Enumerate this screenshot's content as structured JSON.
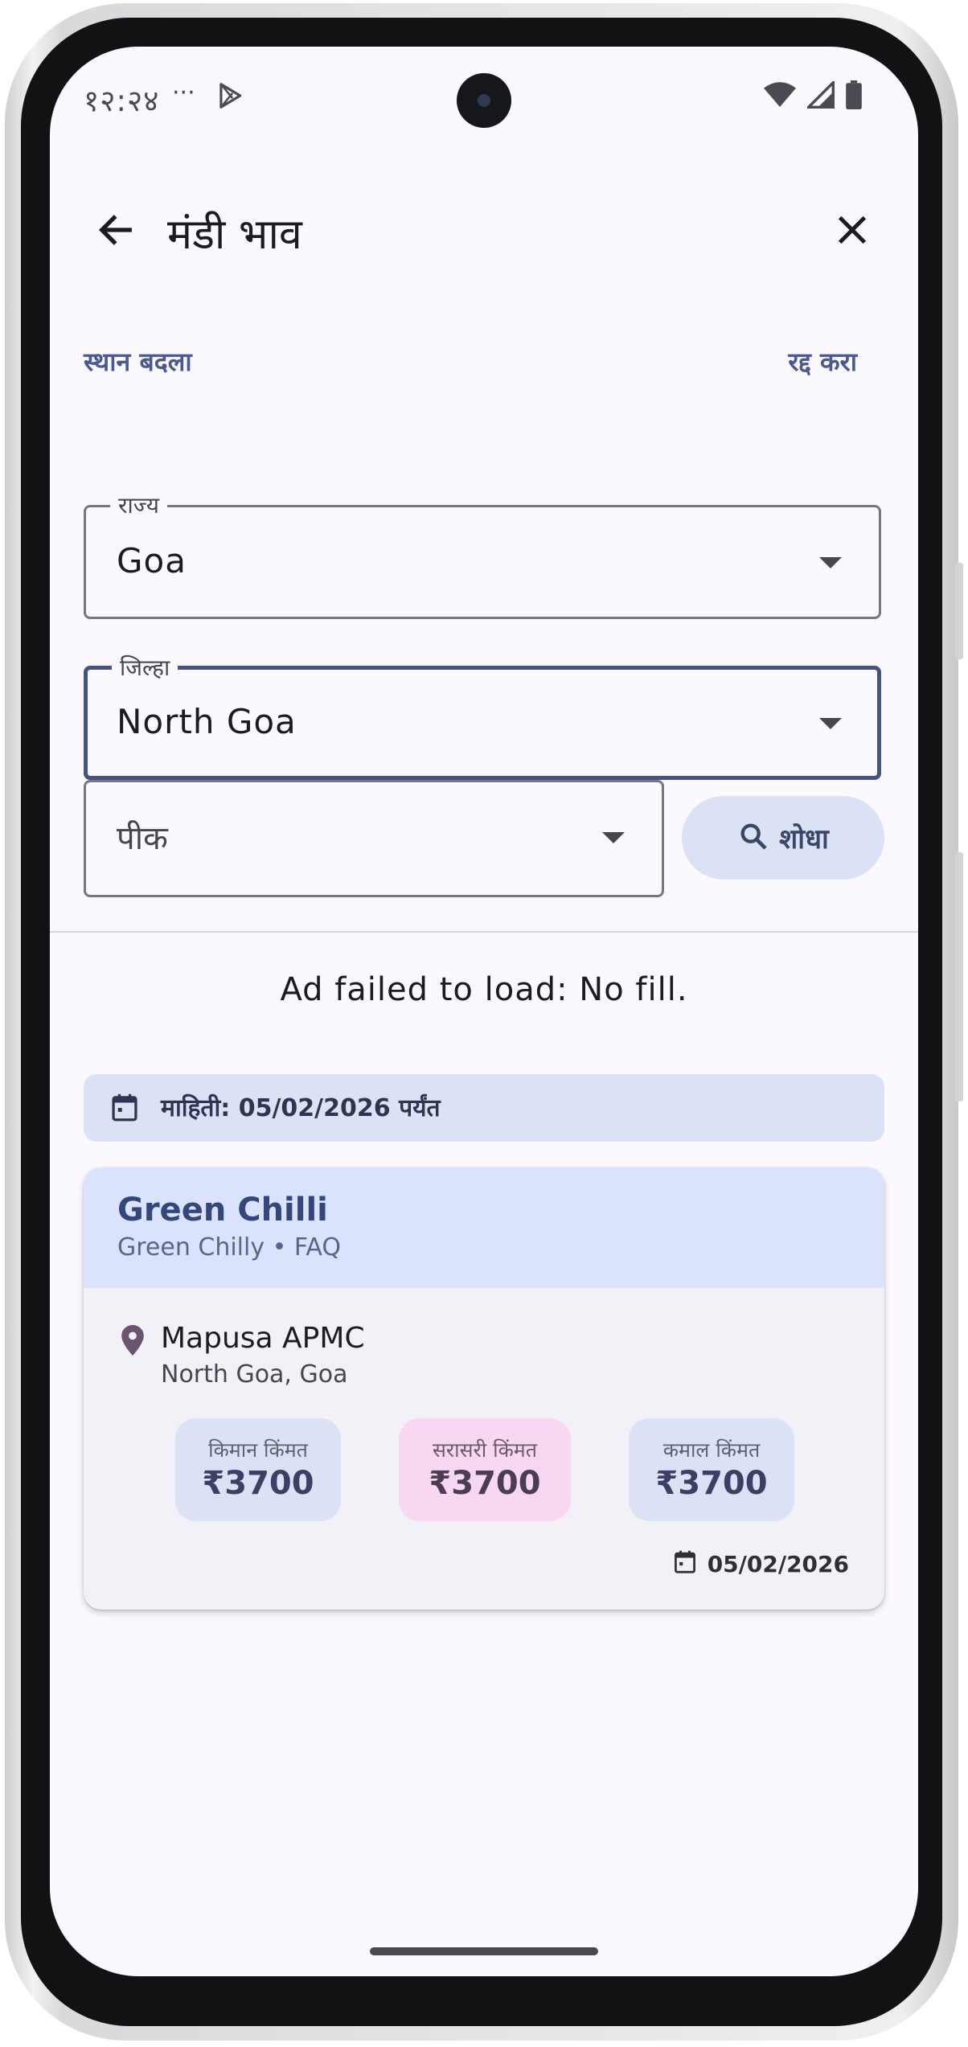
{
  "status_bar": {
    "time": "१२:२४",
    "dots": "···"
  },
  "app_bar": {
    "title": "मंडी भाव"
  },
  "actions": {
    "change_location": "स्थान बदला",
    "cancel": "रद्द करा"
  },
  "fields": {
    "state": {
      "label": "राज्य",
      "value": "Goa"
    },
    "district": {
      "label": "जिल्हा",
      "value": "North Goa"
    },
    "crop": {
      "placeholder": "पीक"
    }
  },
  "search": {
    "label": "शोधा"
  },
  "ad": {
    "message": "Ad failed to load: No fill."
  },
  "info": {
    "text": "माहिती: 05/02/2026 पर्यंत"
  },
  "card": {
    "crop_name": "Green Chilli",
    "variety": "Green Chilly • FAQ",
    "market": "Mapusa APMC",
    "location": "North Goa, Goa",
    "prices": [
      {
        "label": "किमान किंमत",
        "value": "₹3700"
      },
      {
        "label": "सरासरी किंमत",
        "value": "₹3700"
      },
      {
        "label": "कमाल किंमत",
        "value": "₹3700"
      }
    ],
    "date": "05/02/2026"
  },
  "colors": {
    "accent": "#44537f",
    "header_bg": "#dbe2fb",
    "modal_bg": "#f8d8f1",
    "chip_bg": "#dce2f5"
  }
}
